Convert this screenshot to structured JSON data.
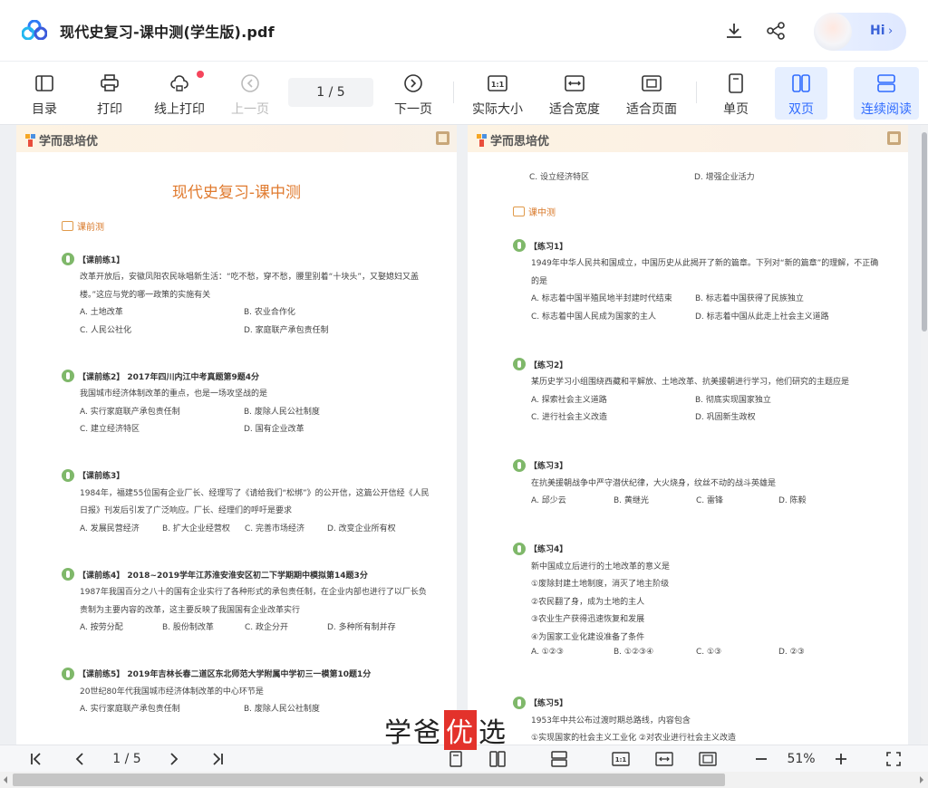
{
  "app": {
    "title": "现代史复习-课中测(学生版).pdf",
    "hi_label": "Hi",
    "hi_chevron": "›"
  },
  "toolbar": {
    "catalog": "目录",
    "print": "打印",
    "online_print": "线上打印",
    "prev_page": "上一页",
    "page_indicator": "1  /  5",
    "next_page": "下一页",
    "actual_size": "实际大小",
    "fit_width": "适合宽度",
    "fit_page": "适合页面",
    "single_page": "单页",
    "double_page": "双页",
    "continuous": "连续阅读",
    "actual_size_icon_text": "1:1"
  },
  "left_page": {
    "brand": "学而思培优",
    "title": "现代史复习-课中测",
    "section": "课前测",
    "questions": [
      {
        "head": "【课前练1】",
        "lines": [
          "改革开放后，安徽凤阳农民咏唱新生活：“吃不愁，穿不愁，腰里别着“十块头”，又娶媳妇又盖",
          "楼。”这应与党的哪一政策的实施有关"
        ],
        "opts": [
          "A. 土地改革",
          "B. 农业合作化",
          "C. 人民公社化",
          "D. 家庭联产承包责任制"
        ]
      },
      {
        "head": "【课前练2】 2017年四川内江中考真题第9题4分",
        "lines": [
          "我国城市经济体制改革的重点，也是一场攻坚战的是"
        ],
        "opts": [
          "A. 实行家庭联产承包责任制",
          "B. 废除人民公社制度",
          "C. 建立经济特区",
          "D. 国有企业改革"
        ]
      },
      {
        "head": "【课前练3】",
        "lines": [
          "1984年，福建55位国有企业厂长、经理写了《请给我们“松绑”》的公开信，这篇公开信经《人民",
          "日报》刊发后引发了广泛响应。厂长、经理们的呼吁是要求"
        ],
        "opts": [
          "A. 发展民营经济",
          "B. 扩大企业经营权",
          "C. 完善市场经济",
          "D. 改变企业所有权"
        ]
      },
      {
        "head": "【课前练4】 2018~2019学年江苏淮安淮安区初二下学期期中模拟第14题3分",
        "lines": [
          "1987年我国百分之八十的国有企业实行了各种形式的承包责任制，在企业内部也进行了以厂长负",
          "责制为主要内容的改革，这主要反映了我国国有企业改革实行"
        ],
        "opts": [
          "A. 按劳分配",
          "B. 股份制改革",
          "C. 政企分开",
          "D. 多种所有制并存"
        ]
      },
      {
        "head": "【课前练5】 2019年吉林长春二道区东北师范大学附属中学初三一模第10题1分",
        "lines": [
          "20世纪80年代我国城市经济体制改革的中心环节是"
        ],
        "opts": [
          "A. 实行家庭联产承包责任制",
          "B. 废除人民公社制度"
        ]
      }
    ]
  },
  "right_page": {
    "brand": "学而思培优",
    "top_opts": [
      "C. 设立经济特区",
      "D. 增强企业活力"
    ],
    "section": "课中测",
    "questions": [
      {
        "head": "【练习1】",
        "lines": [
          "1949年中华人民共和国成立，中国历史从此揭开了新的篇章。下列对“新的篇章”的理解，不正确",
          "的是"
        ],
        "opts": [
          "A. 标志着中国半殖民地半封建时代结束",
          "B. 标志着中国获得了民族独立",
          "C. 标志着中国人民成为国家的主人",
          "D. 标志着中国从此走上社会主义道路"
        ]
      },
      {
        "head": "【练习2】",
        "lines": [
          "某历史学习小组围绕西藏和平解放、土地改革、抗美援朝进行学习，他们研究的主题应是"
        ],
        "opts": [
          "A. 探索社会主义道路",
          "B. 彻底实现国家独立",
          "C. 进行社会主义改造",
          "D. 巩固新生政权"
        ]
      },
      {
        "head": "【练习3】",
        "lines": [
          "在抗美援朝战争中严守潜伏纪律，大火烧身，纹丝不动的战斗英雄是"
        ],
        "opts": [
          "A. 邱少云",
          "B. 黄继光",
          "C. 雷锋",
          "D. 陈毅"
        ]
      },
      {
        "head": "【练习4】",
        "lines": [
          "新中国成立后进行的土地改革的意义是",
          "①废除封建土地制度，消灭了地主阶级",
          "②农民翻了身，成为土地的主人",
          "③农业生产获得迅速恢复和发展",
          "④为国家工业化建设准备了条件"
        ],
        "opts": [
          "A. ①②③",
          "B. ①②③④",
          "C. ①③",
          "D. ②③"
        ]
      },
      {
        "head": "【练习5】",
        "lines": [
          "1953年中共公布过渡时期总路线，内容包含",
          "①实现国家的社会主义工业化  ②对农业进行社会主义改造"
        ],
        "opts": []
      }
    ]
  },
  "bottom": {
    "page_indicator": "1  /  5",
    "zoom": "51%",
    "actual_size_icon_text": "1:1"
  },
  "watermark": {
    "part1": "学爸",
    "highlight": "优",
    "part2": "选"
  }
}
